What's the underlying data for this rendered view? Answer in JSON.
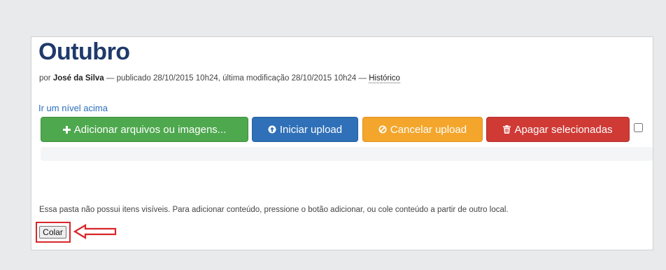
{
  "page": {
    "title": "Outubro",
    "byline": {
      "prefix": "por ",
      "author": "José da Silva",
      "middle": " — publicado 28/10/2015 10h24, última modificação 28/10/2015 10h24 — ",
      "history_link": "Histórico"
    },
    "up_link": "Ir um nível acima"
  },
  "toolbar": {
    "add_label": "Adicionar arquivos ou imagens...",
    "add_icon": "plus-icon",
    "upload_label": "Iniciar upload",
    "upload_icon": "circle-arrow-up-icon",
    "cancel_label": "Cancelar upload",
    "cancel_icon": "ban-icon",
    "delete_label": "Apagar selecionadas",
    "delete_icon": "trash-icon",
    "colors": {
      "add": "#4ea84e",
      "upload": "#2f70b8",
      "cancel": "#f4a62c",
      "delete": "#cf3a35"
    }
  },
  "content": {
    "empty_message": "Essa pasta não possui itens visíveis. Para adicionar conteúdo, pressione o botão adicionar, ou cole conteúdo a partir de outro local.",
    "paste_label": "Colar",
    "highlight_color": "#d9262a"
  }
}
